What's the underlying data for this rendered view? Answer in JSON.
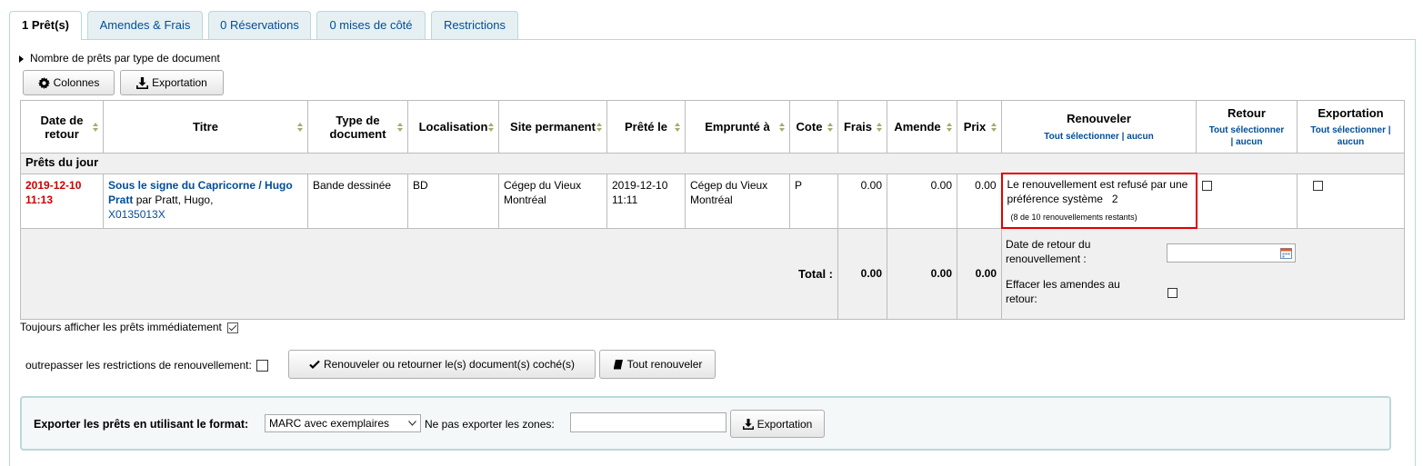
{
  "tabs": [
    "1 Prêt(s)",
    "Amendes & Frais",
    "0 Réservations",
    "0 mises de côté",
    "Restrictions"
  ],
  "toggle_label": "Nombre de prêts par type de document",
  "buttons": {
    "columns": "Colonnes",
    "export": "Exportation"
  },
  "table": {
    "headers": {
      "due_date": "Date de retour",
      "title": "Titre",
      "item_type": "Type de document",
      "location": "Localisation",
      "home_library": "Site permanent",
      "checkout_date": "Prêté le",
      "checked_out_from": "Emprunté à",
      "call_number": "Cote",
      "charge": "Frais",
      "fine": "Amende",
      "price": "Prix",
      "renew": "Renouveler",
      "checkin": "Retour",
      "export": "Exportation"
    },
    "select_all": "Tout sélectionner",
    "separator": "|",
    "select_none": "aucun",
    "group_label": "Prêts du jour",
    "row": {
      "due_date": "2019-12-10 11:13",
      "title": "Sous le signe du Capricorne / Hugo Pratt",
      "author": "par Pratt, Hugo,",
      "barcode": "X0135013X",
      "item_type": "Bande dessinée",
      "location": "BD",
      "home_library": "Cégep du Vieux Montréal",
      "checkout_date": "2019-12-10 11:11",
      "checked_out_from": "Cégep du Vieux Montréal",
      "call_number": "P",
      "charge": "0.00",
      "fine": "0.00",
      "price": "0.00",
      "renew_message": "Le renouvellement est refusé par une préférence système",
      "renew_count": "2",
      "renew_remaining": "(8 de 10 renouvellements restants)"
    },
    "total": {
      "label": "Total :",
      "charge": "0.00",
      "fine": "0.00",
      "price": "0.00",
      "renew_due_label": "Date de retour du renouvellement :",
      "forgive_fines_label": "Effacer les amendes au retour:"
    }
  },
  "always_show_label": "Toujours afficher les prêts immédiatement",
  "override_label": "outrepasser les restrictions de renouvellement:",
  "renew_return_button": "Renouveler ou retourner le(s) document(s) coché(s)",
  "renew_all_button": "Tout renouveler",
  "export_form": {
    "label": "Exporter les prêts en utilisant le format:",
    "format_value": "MARC avec exemplaires",
    "no_export_label": "Ne pas exporter les zones:",
    "no_export_value": "",
    "button": "Exportation"
  },
  "colors": {
    "link": "#004d99",
    "due": "#cc0000",
    "tab_bg": "#e6f0f2",
    "highlight": "#e00000"
  }
}
